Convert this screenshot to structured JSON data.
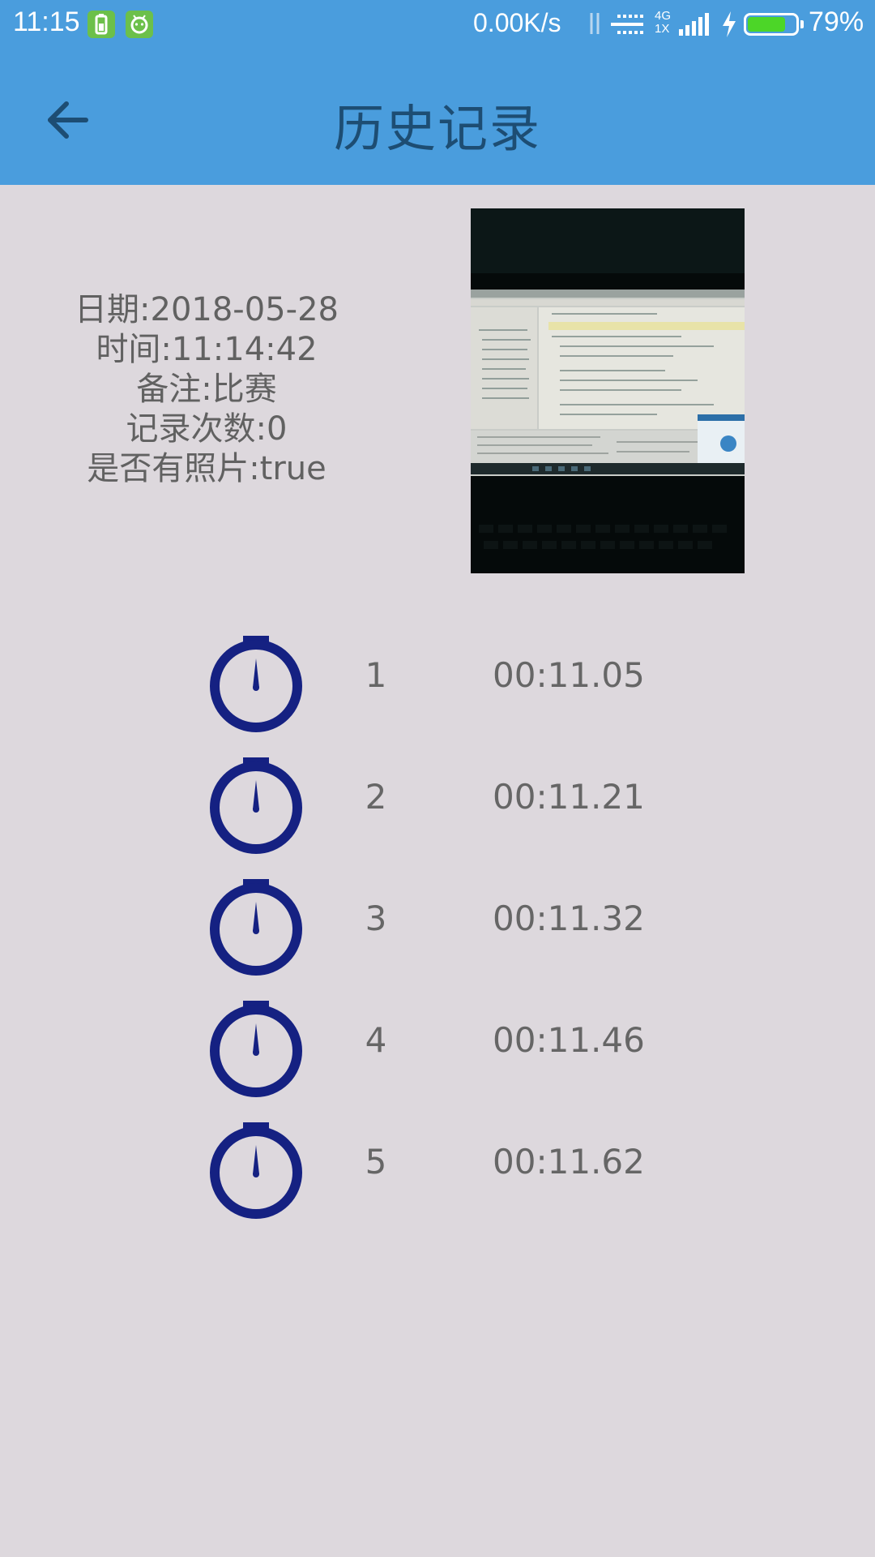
{
  "status_bar": {
    "time": "11:15",
    "net_speed": "0.00K/s",
    "network_label_top": "4G",
    "network_label_bottom": "1X",
    "battery_level": 0.79,
    "battery_text": "79%",
    "colors": {
      "background": "#4a9ddd",
      "battery_fill": "#4cd628",
      "badge": "#6cc04a"
    }
  },
  "app_bar": {
    "title": "历史记录",
    "back_icon": "arrow-left-icon",
    "colors": {
      "background": "#4a9ddd",
      "title": "#1d4d73"
    }
  },
  "summary": {
    "date": "日期:2018-05-28",
    "time": "时间:11:14:42",
    "note": "备注:比赛",
    "record_count": "记录次数:0",
    "has_photo": "是否有照片:true"
  },
  "records": [
    {
      "index": "1",
      "time": "00:11.05"
    },
    {
      "index": "2",
      "time": "00:11.21"
    },
    {
      "index": "3",
      "time": "00:11.32"
    },
    {
      "index": "4",
      "time": "00:11.46"
    },
    {
      "index": "5",
      "time": "00:11.62"
    }
  ],
  "icons": {
    "record": "stopwatch-icon"
  },
  "colors": {
    "page_background": "#ddd8dd",
    "text": "#616161",
    "stopwatch": "#152182"
  }
}
